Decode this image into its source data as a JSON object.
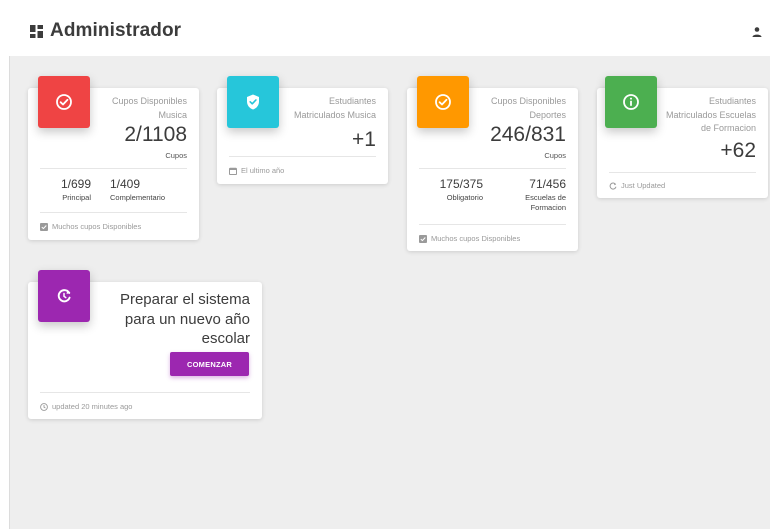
{
  "header": {
    "title": "Administrador"
  },
  "colors": {
    "red": "#ef4444",
    "cyan": "#26c6da",
    "orange": "#ff9800",
    "green": "#4caf50",
    "purple": "#9c27b0"
  },
  "cards": {
    "music": {
      "icon": "check-circle-icon",
      "category_line1": "Cupos Disponibles",
      "category_line2": "Musica",
      "value": "2/1108",
      "unit": "Cupos",
      "stats": [
        {
          "value": "1/699",
          "label": "Principal"
        },
        {
          "value": "1/409",
          "label": "Complementario"
        }
      ],
      "footer": "Muchos cupos Disponibles"
    },
    "students_music": {
      "icon": "shield-check-icon",
      "category_line1": "Estudiantes",
      "category_line2": "Matriculados Musica",
      "value": "+1",
      "footer": "El ultimo año"
    },
    "sports": {
      "icon": "check-circle-icon",
      "category_line1": "Cupos Disponibles",
      "category_line2": "Deportes",
      "value": "246/831",
      "unit": "Cupos",
      "stats": [
        {
          "value": "175/375",
          "label": "Obligatorio"
        },
        {
          "value": "71/456",
          "label_line1": "Escuelas de",
          "label_line2": "Formacion"
        }
      ],
      "footer": "Muchos cupos Disponibles"
    },
    "students_schools": {
      "icon": "info-circle-icon",
      "category_line1": "Estudiantes",
      "category_line2": "Matriculados Escuelas",
      "category_line3": "de Formacion",
      "value": "+62",
      "footer": "Just Updated"
    },
    "prepare": {
      "icon": "refresh-icon",
      "title_line1": "Preparar el sistema",
      "title_line2": "para un nuevo año",
      "title_line3": "escolar",
      "button_label": "COMENZAR",
      "footer": "updated 20 minutes ago"
    }
  }
}
